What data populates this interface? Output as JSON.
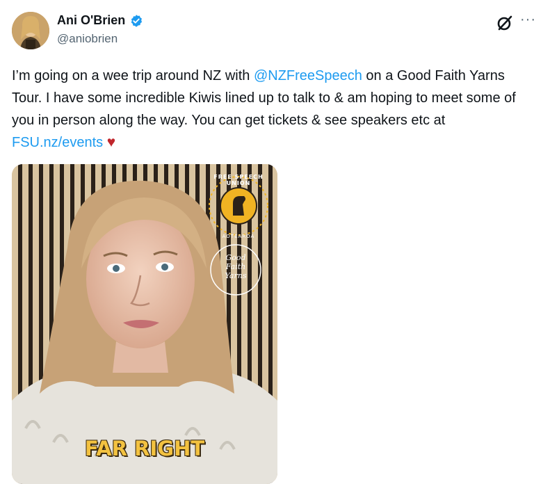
{
  "user": {
    "display_name": "Ani O'Brien",
    "handle": "@aniobrien",
    "verified_color": "#1d9bf0"
  },
  "icons": {
    "grok": "grok-icon",
    "more": "more-icon",
    "verified": "verified-badge-icon",
    "more_glyph": "···"
  },
  "tweet": {
    "text_1": "I’m going on a wee trip around NZ with ",
    "mention": "@NZFreeSpeech",
    "text_2": " on a Good Faith Yarns Tour. I have some incredible Kiwis lined up to talk to & am hoping to meet some of you in person along the way. You can get tickets & see speakers etc at ",
    "link": "FSU.nz/events",
    "emoji": "♥"
  },
  "media": {
    "logo_text": "FREE SPEECH UNION",
    "logo_subtext": "AOTEAROA",
    "badge_text_1": "Good",
    "badge_text_2": "Faith",
    "badge_text_3": "Yarns",
    "caption": "FAR RIGHT"
  },
  "colors": {
    "link": "#1d9bf0",
    "text": "#0f1419",
    "secondary": "#536471",
    "caption": "#f3c240",
    "logo": "#f0b323"
  }
}
